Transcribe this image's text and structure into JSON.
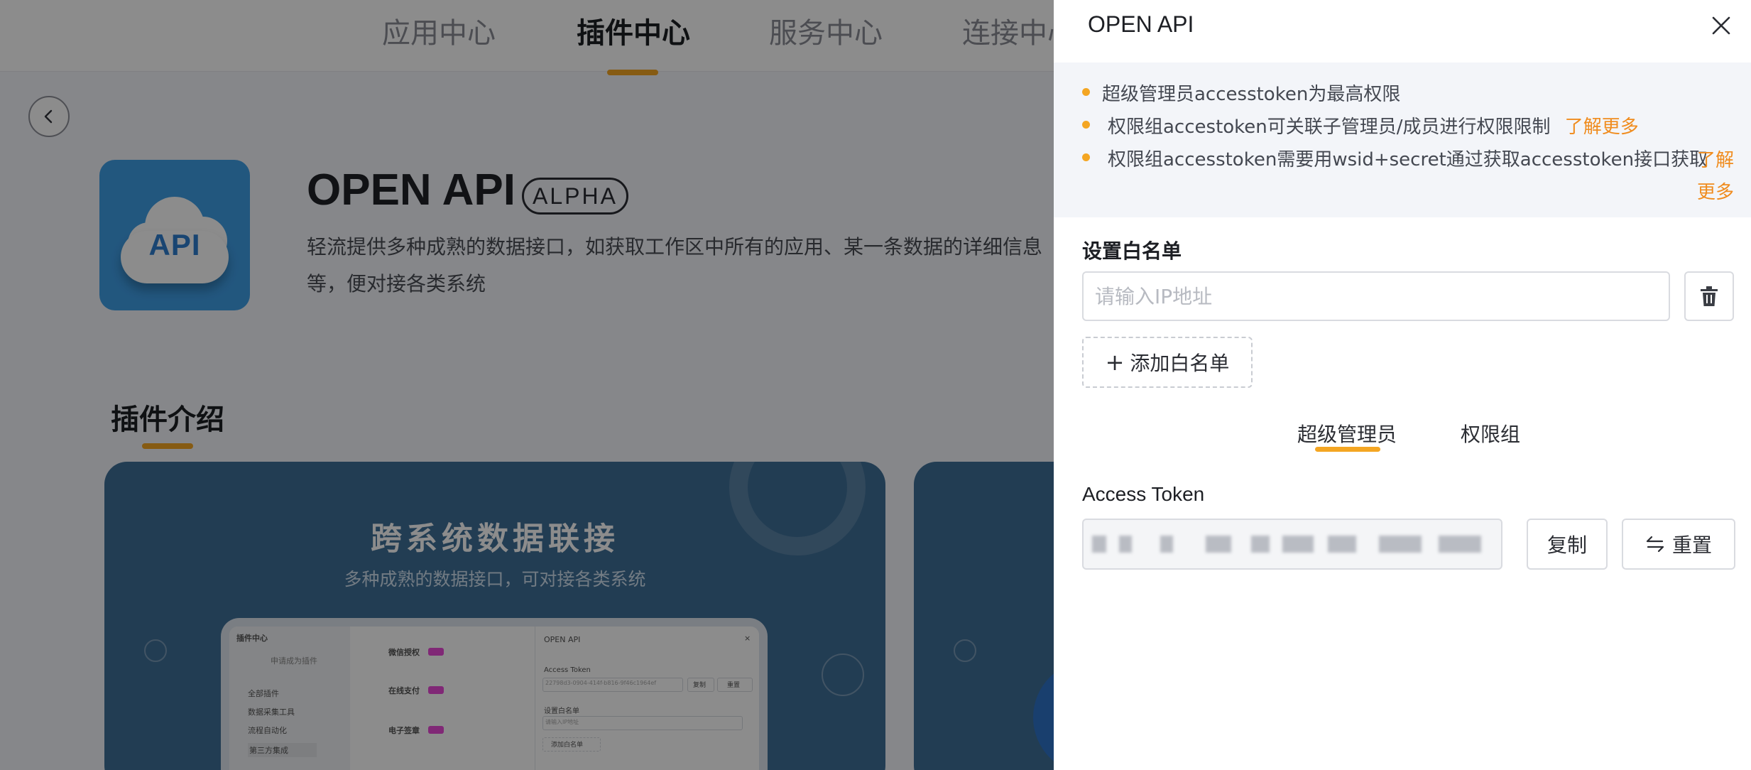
{
  "nav": {
    "tabs": [
      {
        "label": "应用中心"
      },
      {
        "label": "插件中心"
      },
      {
        "label": "服务中心"
      },
      {
        "label": "连接中心"
      }
    ],
    "active_index": 1
  },
  "hero": {
    "icon_text": "API",
    "title": "OPEN API",
    "badge": "ALPHA",
    "description": "轻流提供多种成熟的数据接口，如获取工作区中所有的应用、某一条数据的详细信息等，便对接各类系统"
  },
  "intro": {
    "title": "插件介绍",
    "card_title": "跨系统数据联接",
    "card_subtitle": "多种成熟的数据接口，可对接各类系统"
  },
  "mini_preview": {
    "sidebar_title": "插件中心",
    "sidebar_subtitle": "申请成为插件",
    "sidebar_items": [
      "全部插件",
      "数据采集工具",
      "流程自动化",
      "第三方集成"
    ],
    "list_items": [
      "微信授权",
      "在线支付",
      "电子签章"
    ],
    "panel_title": "OPEN API",
    "panel_access_token": "Access Token",
    "panel_token_value": "22798d3-0904-414f-b816-9f46c1964ef",
    "panel_copy": "复制",
    "panel_reset": "重置",
    "panel_whitelist": "设置白名单",
    "panel_ip_placeholder": "请输入IP地址",
    "panel_add": "添加白名单"
  },
  "drawer": {
    "title": "OPEN API",
    "notices": [
      {
        "text": "超级管理员accesstoken为最高权限",
        "link": ""
      },
      {
        "text": "权限组accestoken可关联子管理员/成员进行权限限制",
        "link": "了解更多"
      },
      {
        "text": "权限组accesstoken需要用wsid+secret通过获取accesstoken接口获取",
        "link": "了解更多"
      }
    ],
    "whitelist_label": "设置白名单",
    "ip_placeholder": "请输入IP地址",
    "add_whitelist": "添加白名单",
    "tabs": [
      {
        "label": "超级管理员"
      },
      {
        "label": "权限组"
      }
    ],
    "active_tab": 0,
    "access_token_label": "Access Token",
    "access_token_value": "",
    "copy_button": "复制",
    "reset_button": "重置"
  },
  "colors": {
    "accent": "#f4a623",
    "link": "#f08c1e",
    "card_blue": "#3f6f98",
    "icon_blue": "#3f9ee6"
  }
}
